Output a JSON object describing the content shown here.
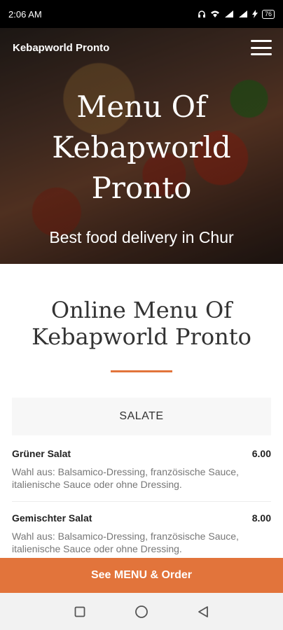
{
  "status_bar": {
    "time": "2:06 AM",
    "battery": "76"
  },
  "header": {
    "brand": "Kebapworld Pronto",
    "menu_icon": "hamburger-icon"
  },
  "hero": {
    "title_line1": "Menu Of",
    "title_line2": "Kebapworld",
    "title_line3": "Pronto",
    "subtitle": "Best food delivery in Chur"
  },
  "section": {
    "title_line1": "Online Menu Of",
    "title_line2": "Kebapworld Pronto",
    "accent_color": "#e2743b"
  },
  "category": {
    "name": "SALATE"
  },
  "items": [
    {
      "name": "Grüner Salat",
      "price": "6.00",
      "description": "Wahl aus: Balsamico-Dressing, französische Sauce, italienische Sauce oder ohne Dressing."
    },
    {
      "name": "Gemischter Salat",
      "price": "8.00",
      "description": "Wahl aus: Balsamico-Dressing, französische Sauce, italienische Sauce oder ohne Dressing."
    }
  ],
  "cta": {
    "label": "See MENU & Order"
  },
  "nav": {
    "recents_icon": "square-icon",
    "home_icon": "circle-icon",
    "back_icon": "back-triangle-icon"
  }
}
